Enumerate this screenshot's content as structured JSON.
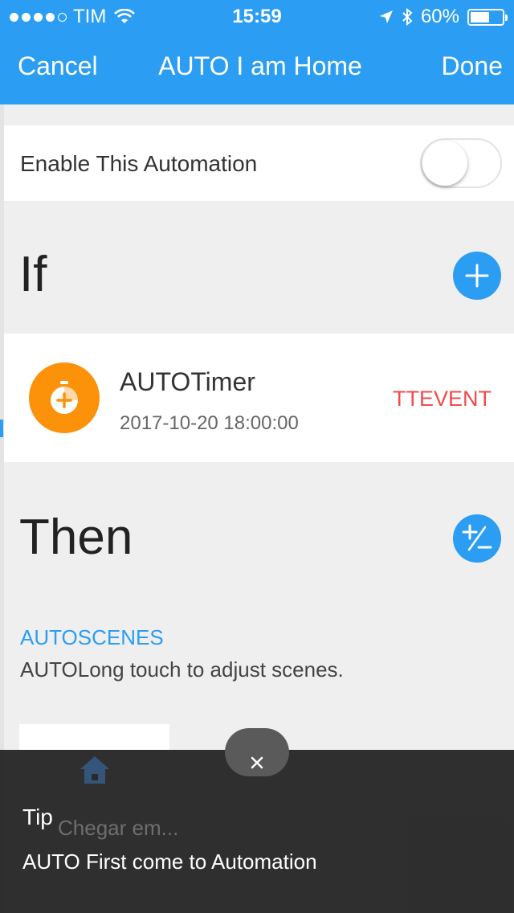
{
  "status_bar": {
    "carrier": "TIM",
    "time": "15:59",
    "battery": "60%",
    "battery_level": 0.6,
    "signal_icon": "signal-dots-icon",
    "wifi_icon": "wifi-icon",
    "location_icon": "location-arrow-icon",
    "bluetooth_icon": "bluetooth-icon"
  },
  "nav": {
    "cancel": "Cancel",
    "title": "AUTO I am Home",
    "done": "Done"
  },
  "enable": {
    "label": "Enable This Automation",
    "on": false
  },
  "if_section": {
    "title": "If",
    "add_icon": "plus-icon",
    "condition": {
      "icon": "timer-icon",
      "name": "AUTOTimer",
      "datetime": "2017-10-20 18:00:00",
      "event": "TTEVENT"
    }
  },
  "then_section": {
    "title": "Then",
    "edit_icon": "plus-minus-icon",
    "scenes_label": "AUTOSCENES",
    "scenes_hint": "AUTOLong touch to adjust scenes."
  },
  "tip": {
    "title": "Tip",
    "message": "AUTO First come to Automation",
    "close_icon": "close-icon",
    "background_text": "Chegar em..."
  },
  "colors": {
    "accent": "#2b9ef4",
    "timer": "#fb9209",
    "event": "#f24b4b",
    "tip_bg": "#262626"
  }
}
